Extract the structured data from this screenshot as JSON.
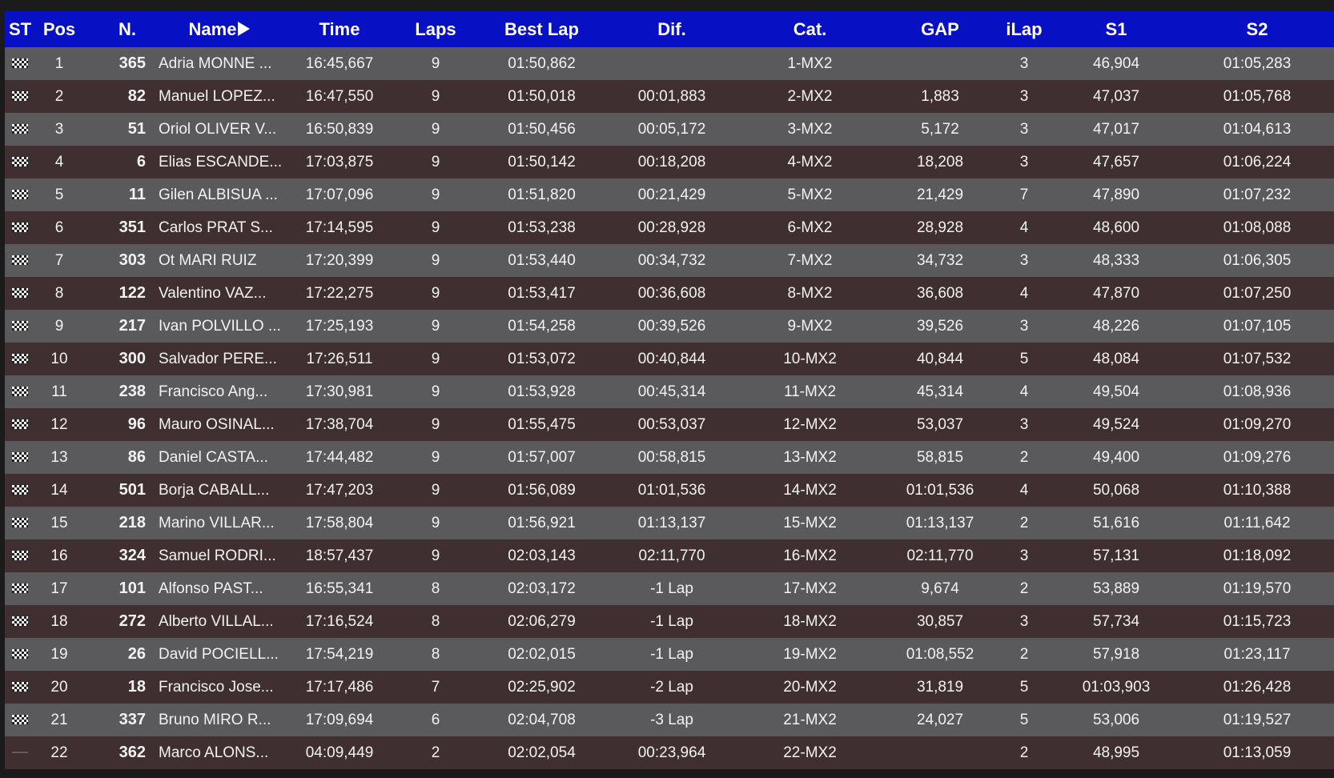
{
  "header": {
    "st": "ST",
    "pos": "Pos",
    "num": "N.",
    "name": "Name",
    "time": "Time",
    "laps": "Laps",
    "best_lap": "Best Lap",
    "dif": "Dif.",
    "cat": "Cat.",
    "gap": "GAP",
    "ilap": "iLap",
    "s1": "S1",
    "s2": "S2"
  },
  "sort_icon": "sort-right-triangle-icon",
  "colors": {
    "header_bg": "#0810c4",
    "row_odd": "#5a5a5c",
    "row_even": "#3f2f31"
  },
  "rows": [
    {
      "st": "finished",
      "pos": "1",
      "num": "365",
      "name": "Adria MONNE ...",
      "time": "16:45,667",
      "laps": "9",
      "best": "01:50,862",
      "dif": "",
      "cat": "1-MX2",
      "gap": "",
      "ilap": "3",
      "s1": "46,904",
      "s2": "01:05,283"
    },
    {
      "st": "finished",
      "pos": "2",
      "num": "82",
      "name": "Manuel LOPEZ...",
      "time": "16:47,550",
      "laps": "9",
      "best": "01:50,018",
      "dif": "00:01,883",
      "cat": "2-MX2",
      "gap": "1,883",
      "ilap": "3",
      "s1": "47,037",
      "s2": "01:05,768"
    },
    {
      "st": "finished",
      "pos": "3",
      "num": "51",
      "name": "Oriol OLIVER V...",
      "time": "16:50,839",
      "laps": "9",
      "best": "01:50,456",
      "dif": "00:05,172",
      "cat": "3-MX2",
      "gap": "5,172",
      "ilap": "3",
      "s1": "47,017",
      "s2": "01:04,613"
    },
    {
      "st": "finished",
      "pos": "4",
      "num": "6",
      "name": "Elias ESCANDE...",
      "time": "17:03,875",
      "laps": "9",
      "best": "01:50,142",
      "dif": "00:18,208",
      "cat": "4-MX2",
      "gap": "18,208",
      "ilap": "3",
      "s1": "47,657",
      "s2": "01:06,224"
    },
    {
      "st": "finished",
      "pos": "5",
      "num": "11",
      "name": "Gilen ALBISUA ...",
      "time": "17:07,096",
      "laps": "9",
      "best": "01:51,820",
      "dif": "00:21,429",
      "cat": "5-MX2",
      "gap": "21,429",
      "ilap": "7",
      "s1": "47,890",
      "s2": "01:07,232"
    },
    {
      "st": "finished",
      "pos": "6",
      "num": "351",
      "name": "Carlos PRAT S...",
      "time": "17:14,595",
      "laps": "9",
      "best": "01:53,238",
      "dif": "00:28,928",
      "cat": "6-MX2",
      "gap": "28,928",
      "ilap": "4",
      "s1": "48,600",
      "s2": "01:08,088"
    },
    {
      "st": "finished",
      "pos": "7",
      "num": "303",
      "name": "Ot MARI RUIZ",
      "time": "17:20,399",
      "laps": "9",
      "best": "01:53,440",
      "dif": "00:34,732",
      "cat": "7-MX2",
      "gap": "34,732",
      "ilap": "3",
      "s1": "48,333",
      "s2": "01:06,305"
    },
    {
      "st": "finished",
      "pos": "8",
      "num": "122",
      "name": "Valentino VAZ...",
      "time": "17:22,275",
      "laps": "9",
      "best": "01:53,417",
      "dif": "00:36,608",
      "cat": "8-MX2",
      "gap": "36,608",
      "ilap": "4",
      "s1": "47,870",
      "s2": "01:07,250"
    },
    {
      "st": "finished",
      "pos": "9",
      "num": "217",
      "name": "Ivan POLVILLO ...",
      "time": "17:25,193",
      "laps": "9",
      "best": "01:54,258",
      "dif": "00:39,526",
      "cat": "9-MX2",
      "gap": "39,526",
      "ilap": "3",
      "s1": "48,226",
      "s2": "01:07,105"
    },
    {
      "st": "finished",
      "pos": "10",
      "num": "300",
      "name": "Salvador PERE...",
      "time": "17:26,511",
      "laps": "9",
      "best": "01:53,072",
      "dif": "00:40,844",
      "cat": "10-MX2",
      "gap": "40,844",
      "ilap": "5",
      "s1": "48,084",
      "s2": "01:07,532"
    },
    {
      "st": "finished",
      "pos": "11",
      "num": "238",
      "name": "Francisco Ang...",
      "time": "17:30,981",
      "laps": "9",
      "best": "01:53,928",
      "dif": "00:45,314",
      "cat": "11-MX2",
      "gap": "45,314",
      "ilap": "4",
      "s1": "49,504",
      "s2": "01:08,936"
    },
    {
      "st": "finished",
      "pos": "12",
      "num": "96",
      "name": "Mauro OSINAL...",
      "time": "17:38,704",
      "laps": "9",
      "best": "01:55,475",
      "dif": "00:53,037",
      "cat": "12-MX2",
      "gap": "53,037",
      "ilap": "3",
      "s1": "49,524",
      "s2": "01:09,270"
    },
    {
      "st": "finished",
      "pos": "13",
      "num": "86",
      "name": "Daniel CASTA...",
      "time": "17:44,482",
      "laps": "9",
      "best": "01:57,007",
      "dif": "00:58,815",
      "cat": "13-MX2",
      "gap": "58,815",
      "ilap": "2",
      "s1": "49,400",
      "s2": "01:09,276"
    },
    {
      "st": "finished",
      "pos": "14",
      "num": "501",
      "name": "Borja CABALL...",
      "time": "17:47,203",
      "laps": "9",
      "best": "01:56,089",
      "dif": "01:01,536",
      "cat": "14-MX2",
      "gap": "01:01,536",
      "ilap": "4",
      "s1": "50,068",
      "s2": "01:10,388"
    },
    {
      "st": "finished",
      "pos": "15",
      "num": "218",
      "name": "Marino VILLAR...",
      "time": "17:58,804",
      "laps": "9",
      "best": "01:56,921",
      "dif": "01:13,137",
      "cat": "15-MX2",
      "gap": "01:13,137",
      "ilap": "2",
      "s1": "51,616",
      "s2": "01:11,642"
    },
    {
      "st": "finished",
      "pos": "16",
      "num": "324",
      "name": "Samuel RODRI...",
      "time": "18:57,437",
      "laps": "9",
      "best": "02:03,143",
      "dif": "02:11,770",
      "cat": "16-MX2",
      "gap": "02:11,770",
      "ilap": "3",
      "s1": "57,131",
      "s2": "01:18,092"
    },
    {
      "st": "finished",
      "pos": "17",
      "num": "101",
      "name": "Alfonso PAST...",
      "time": "16:55,341",
      "laps": "8",
      "best": "02:03,172",
      "dif": "-1 Lap",
      "cat": "17-MX2",
      "gap": "9,674",
      "ilap": "2",
      "s1": "53,889",
      "s2": "01:19,570"
    },
    {
      "st": "finished",
      "pos": "18",
      "num": "272",
      "name": "Alberto VILLAL...",
      "time": "17:16,524",
      "laps": "8",
      "best": "02:06,279",
      "dif": "-1 Lap",
      "cat": "18-MX2",
      "gap": "30,857",
      "ilap": "3",
      "s1": "57,734",
      "s2": "01:15,723"
    },
    {
      "st": "finished",
      "pos": "19",
      "num": "26",
      "name": "David POCIELL...",
      "time": "17:54,219",
      "laps": "8",
      "best": "02:02,015",
      "dif": "-1 Lap",
      "cat": "19-MX2",
      "gap": "01:08,552",
      "ilap": "2",
      "s1": "57,918",
      "s2": "01:23,117"
    },
    {
      "st": "finished",
      "pos": "20",
      "num": "18",
      "name": "Francisco Jose...",
      "time": "17:17,486",
      "laps": "7",
      "best": "02:25,902",
      "dif": "-2 Lap",
      "cat": "20-MX2",
      "gap": "31,819",
      "ilap": "5",
      "s1": "01:03,903",
      "s2": "01:26,428"
    },
    {
      "st": "finished",
      "pos": "21",
      "num": "337",
      "name": "Bruno MIRO R...",
      "time": "17:09,694",
      "laps": "6",
      "best": "02:04,708",
      "dif": "-3 Lap",
      "cat": "21-MX2",
      "gap": "24,027",
      "ilap": "5",
      "s1": "53,006",
      "s2": "01:19,527"
    },
    {
      "st": "none",
      "pos": "22",
      "num": "362",
      "name": "Marco ALONS...",
      "time": "04:09,449",
      "laps": "2",
      "best": "02:02,054",
      "dif": "00:23,964",
      "cat": "22-MX2",
      "gap": "",
      "ilap": "2",
      "s1": "48,995",
      "s2": "01:13,059"
    }
  ]
}
